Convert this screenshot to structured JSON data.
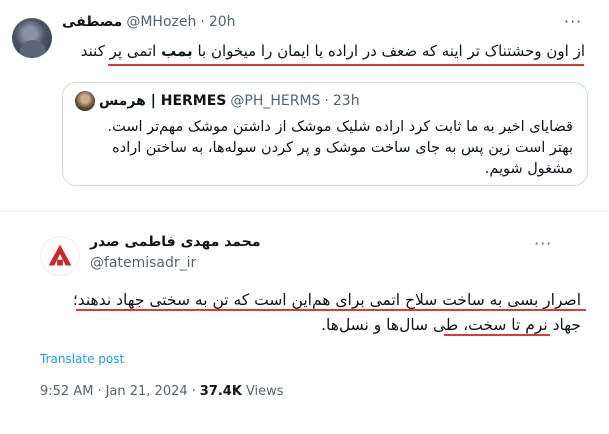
{
  "tweet1": {
    "name": "مصطفی",
    "handle": "@MHozeh",
    "time": "20h",
    "text_before": "از اون وحشتناک تر اینه که ضعف در اراده یا ایمان را میخوان با ",
    "text_bold": "بمب",
    "text_after": " اتمی پر کنند",
    "more_icon": "ellipsis-icon",
    "quote": {
      "name": "هرمس | HERMES",
      "handle": "@PH_HERMS",
      "time": "23h",
      "line1": "قضایای اخیر به ما ثابت کرد اراده شلیک موشک از داشتن موشک مهم‌تر است.",
      "line2": "بهتر است زین پس به جای ساخت موشک و پر کردن سوله‌ها، به ساختن اراده",
      "line3": "مشغول شویم."
    }
  },
  "tweet2": {
    "name": "محمد مهدی فاطمی صدر",
    "handle": "@fatemisadr_ir",
    "line1": "اصرار بسی به ساخت سلاح اتمی برای هم‌این است که تن به سختی جهاد ندهند؛",
    "line2": "جهاد نرم تا سخت، طی سال‌ها و نسل‌ها.",
    "translate": "Translate post",
    "time": "9:52 AM",
    "date": "Jan 21, 2024",
    "views_count": "37.4K",
    "views_label": "Views",
    "more_icon": "ellipsis-icon",
    "avatar_color": "#c62828"
  },
  "colors": {
    "underline": "#d93a3a",
    "link": "#1d9bf0",
    "muted": "#536471"
  }
}
